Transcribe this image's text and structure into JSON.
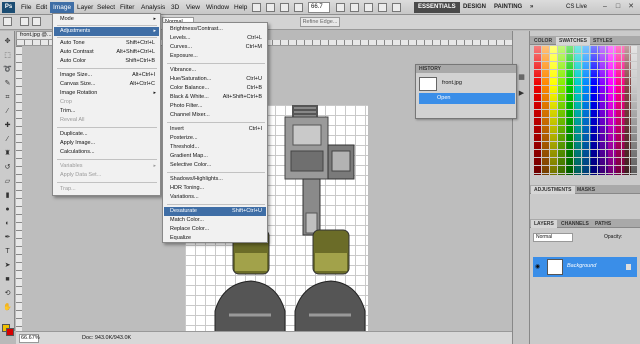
{
  "menubar": {
    "logo": "Ps",
    "items": [
      "File",
      "Edit",
      "Image",
      "Layer",
      "Select",
      "Filter",
      "Analysis",
      "3D",
      "View",
      "Window",
      "Help"
    ],
    "zoom": "66.7",
    "workspaces": [
      "ESSENTIALS",
      "DESIGN",
      "PAINTING",
      "»"
    ],
    "cs_live": "CS Live",
    "window_controls": [
      "–",
      "□",
      "✕"
    ]
  },
  "options": {
    "style_value": "Normal",
    "refine_edge": "Refine Edge..."
  },
  "document": {
    "tab": "front.jpg @...",
    "zoom_status": "66.67%",
    "doc_size": "Doc: 943.0K/943.0K"
  },
  "image_menu": {
    "items": [
      {
        "label": "Mode",
        "shortcut": "",
        "submenu": true,
        "disabled": false
      },
      {
        "label": "Adjustments",
        "shortcut": "",
        "submenu": true,
        "disabled": false,
        "highlighted": true
      },
      {
        "label": "Auto Tone",
        "shortcut": "Shift+Ctrl+L",
        "disabled": false
      },
      {
        "label": "Auto Contrast",
        "shortcut": "Alt+Shift+Ctrl+L",
        "disabled": false
      },
      {
        "label": "Auto Color",
        "shortcut": "Shift+Ctrl+B",
        "disabled": false
      },
      {
        "label": "Image Size...",
        "shortcut": "Alt+Ctrl+I",
        "disabled": false
      },
      {
        "label": "Canvas Size...",
        "shortcut": "Alt+Ctrl+C",
        "disabled": false
      },
      {
        "label": "Image Rotation",
        "shortcut": "",
        "submenu": true,
        "disabled": false
      },
      {
        "label": "Crop",
        "shortcut": "",
        "disabled": true
      },
      {
        "label": "Trim...",
        "shortcut": "",
        "disabled": false
      },
      {
        "label": "Reveal All",
        "shortcut": "",
        "disabled": true
      },
      {
        "label": "Duplicate...",
        "shortcut": "",
        "disabled": false
      },
      {
        "label": "Apply Image...",
        "shortcut": "",
        "disabled": false
      },
      {
        "label": "Calculations...",
        "shortcut": "",
        "disabled": false
      },
      {
        "label": "Variables",
        "shortcut": "",
        "submenu": true,
        "disabled": true
      },
      {
        "label": "Apply Data Set...",
        "shortcut": "",
        "disabled": true
      },
      {
        "label": "Trap...",
        "shortcut": "",
        "disabled": true
      }
    ]
  },
  "adjustments_menu": {
    "items": [
      {
        "label": "Brightness/Contrast...",
        "shortcut": ""
      },
      {
        "label": "Levels...",
        "shortcut": "Ctrl+L"
      },
      {
        "label": "Curves...",
        "shortcut": "Ctrl+M"
      },
      {
        "label": "Exposure...",
        "shortcut": ""
      },
      {
        "label": "Vibrance...",
        "shortcut": ""
      },
      {
        "label": "Hue/Saturation...",
        "shortcut": "Ctrl+U"
      },
      {
        "label": "Color Balance...",
        "shortcut": "Ctrl+B"
      },
      {
        "label": "Black & White...",
        "shortcut": "Alt+Shift+Ctrl+B"
      },
      {
        "label": "Photo Filter...",
        "shortcut": ""
      },
      {
        "label": "Channel Mixer...",
        "shortcut": ""
      },
      {
        "label": "Invert",
        "shortcut": "Ctrl+I"
      },
      {
        "label": "Posterize...",
        "shortcut": ""
      },
      {
        "label": "Threshold...",
        "shortcut": ""
      },
      {
        "label": "Gradient Map...",
        "shortcut": ""
      },
      {
        "label": "Selective Color...",
        "shortcut": ""
      },
      {
        "label": "Shadows/Highlights...",
        "shortcut": ""
      },
      {
        "label": "HDR Toning...",
        "shortcut": ""
      },
      {
        "label": "Variations...",
        "shortcut": ""
      },
      {
        "label": "Desaturate",
        "shortcut": "Shift+Ctrl+U",
        "highlighted": true
      },
      {
        "label": "Match Color...",
        "shortcut": ""
      },
      {
        "label": "Replace Color...",
        "shortcut": ""
      },
      {
        "label": "Equalize",
        "shortcut": ""
      }
    ]
  },
  "history": {
    "title": "HISTORY",
    "snapshot": "front.jpg",
    "step": "Open"
  },
  "swatches_panel": {
    "tabs": [
      "COLOR",
      "SWATCHES",
      "STYLES"
    ]
  },
  "adjustments_panel": {
    "tabs": [
      "ADJUSTMENTS",
      "MASKS"
    ]
  },
  "layers_panel": {
    "tabs": [
      "LAYERS",
      "CHANNELS",
      "PATHS"
    ],
    "blend_mode": "Normal",
    "opacity_label": "Opacity:",
    "layer_name": "Background"
  },
  "colors": {
    "menu_highlight": "#3f6ea6",
    "layer_selected": "#3a8ee8",
    "foreground": "#f0c000",
    "background": "#d60000"
  }
}
